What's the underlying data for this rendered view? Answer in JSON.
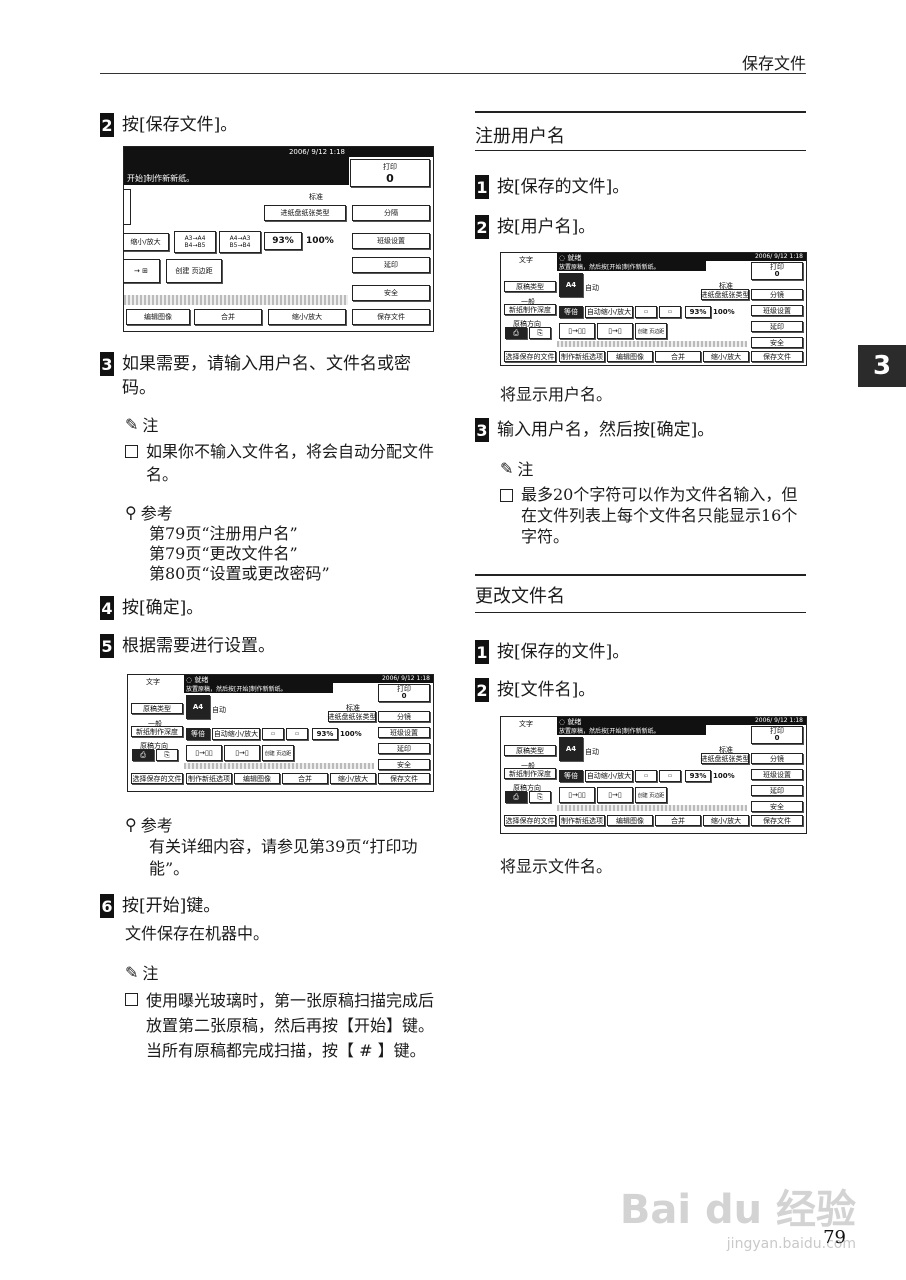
{
  "header": {
    "title": "保存文件"
  },
  "chapter_tab": "3",
  "left": {
    "step2": {
      "num": "2",
      "text": "按[保存文件]。"
    },
    "screen1": {
      "date": "2006/ 9/12   1:18",
      "print_label": "打印",
      "print_count": "0",
      "msg": "开始]制作新新纸。",
      "std": "标准",
      "paper_type": "进纸盘纸张类型",
      "zoom": "缩小/放大",
      "r1": "A3→A4 B4→B5",
      "r2": "A4→A3 B5→B4",
      "pct": "93%",
      "pct100": "100%",
      "edge": "创建 页边距",
      "sort": "分隔",
      "advanced": "班级设置",
      "delay": "延印",
      "safe": "安全",
      "save": "保存文件",
      "tabs": [
        "编辑图像",
        "合并",
        "缩小/放大"
      ]
    },
    "step3": {
      "num": "3",
      "text": "如果需要，请输入用户名、文件名或密码。"
    },
    "note1": {
      "head": "注",
      "text": "如果你不输入文件名，将会自动分配文件名。"
    },
    "ref1": {
      "head": "参考",
      "lines": [
        "第79页“注册用户名”",
        "第79页“更改文件名”",
        "第80页“设置或更改密码”"
      ]
    },
    "step4": {
      "num": "4",
      "text": "按[确定]。"
    },
    "step5": {
      "num": "5",
      "text": "根据需要进行设置。"
    },
    "ref2": {
      "head": "参考",
      "text": "有关详细内容，请参见第39页“打印功能”。"
    },
    "step6": {
      "num": "6",
      "text": "按[开始]键。"
    },
    "step6_desc": "文件保存在机器中。",
    "note2": {
      "head": "注",
      "text": "使用曝光玻璃时，第一张原稿扫描完成后放置第二张原稿，然后再按【开始】键。当所有原稿都完成扫描，按【 # 】键。"
    }
  },
  "right": {
    "sec1_title": "注册用户名",
    "s1_step1": {
      "num": "1",
      "text": "按[保存的文件]。"
    },
    "s1_step2": {
      "num": "2",
      "text": "按[用户名]。"
    },
    "s1_after": "将显示用户名。",
    "s1_step3": {
      "num": "3",
      "text": "输入用户名，然后按[确定]。"
    },
    "note3": {
      "head": "注",
      "text": "最多20个字符可以作为文件名输入，但在文件列表上每个文件名只能显示16个字符。"
    },
    "sec2_title": "更改文件名",
    "s2_step1": {
      "num": "1",
      "text": "按[保存的文件]。"
    },
    "s2_step2": {
      "num": "2",
      "text": "按[文件名]。"
    },
    "s2_after": "将显示文件名。"
  },
  "small_screen": {
    "date": "2006/ 9/12   1:18",
    "print_label": "打印",
    "print_count": "0",
    "ready": "就绪",
    "msg": "放置原稿，然后按[开始]制作新新纸。",
    "doc": "文字",
    "orig_type": "原稿类型",
    "general": "一般",
    "density": "新纸制作深度",
    "orient": "原稿方向",
    "std": "标准",
    "paper_type": "进纸盘纸张类型",
    "same": "等倍",
    "auto_zoom": "自动缩小/放大",
    "pct": "93%",
    "pct100": "100%",
    "edge": "创建 页边距",
    "auto": "自动",
    "a4": "A4",
    "sort": "分镜",
    "advanced": "班级设置",
    "delay": "延印",
    "safe": "安全",
    "save": "保存文件",
    "tabs": [
      "选择保存的文件",
      "制作新纸选项",
      "编辑图像",
      "合并",
      "缩小/放大"
    ]
  },
  "watermark": {
    "logo": "Bai du 经验",
    "url": "jingyan.baidu.com"
  },
  "page_number": "79"
}
